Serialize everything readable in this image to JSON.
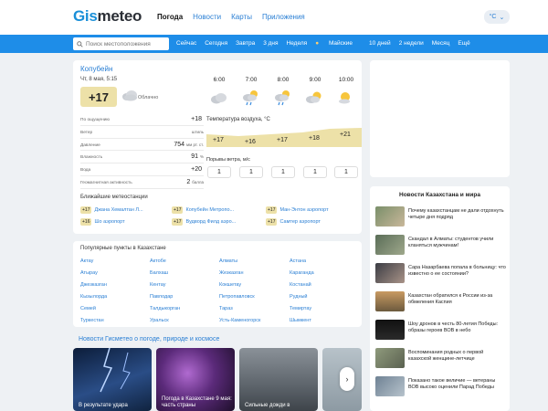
{
  "header": {
    "logo_g": "Gis",
    "logo_m": "meteo",
    "nav": [
      "Погода",
      "Новости",
      "Карты",
      "Приложения"
    ],
    "unit": "°C"
  },
  "search": {
    "placeholder": "Поиск местоположения"
  },
  "daynav": [
    "Сейчас",
    "Сегодня",
    "Завтра",
    "3 дня",
    "Неделя",
    "Майские",
    "10 дней",
    "2 недели",
    "Месяц",
    "Ещё"
  ],
  "current": {
    "city": "Копубейн",
    "datetime": "Чт, 8 мая, 5:15",
    "temp": "+17",
    "desc": "Облачно",
    "params": [
      {
        "k": "По ощущению",
        "v": "+18",
        "u": ""
      },
      {
        "k": "Ветер",
        "v": "",
        "u": "штиль"
      },
      {
        "k": "Давление",
        "v": "754",
        "u": "мм рт. ст."
      },
      {
        "k": "Влажность",
        "v": "91",
        "u": "%"
      },
      {
        "k": "Вода",
        "v": "+20",
        "u": ""
      },
      {
        "k": "Геомагнитная активность",
        "v": "2",
        "u": "балла"
      }
    ]
  },
  "hourly": {
    "times": [
      "6:00",
      "7:00",
      "8:00",
      "9:00",
      "10:00"
    ],
    "temp_header": "Температура воздуха, °С",
    "temps": [
      "+17",
      "+16",
      "+17",
      "+18",
      "+21"
    ],
    "gust_header": "Порывы ветра, м/с",
    "gusts": [
      "1",
      "1",
      "1",
      "1",
      "1"
    ]
  },
  "stations": {
    "title": "Ближайшие метеостанции",
    "items": [
      {
        "t": "+17",
        "n": "Джана Хемалтан Л..."
      },
      {
        "t": "+17",
        "n": "Копубейн Метропо..."
      },
      {
        "t": "+17",
        "n": "Ман-Энтон аэропорт"
      },
      {
        "t": "+16",
        "n": "Шо аэропорт"
      },
      {
        "t": "+17",
        "n": "Вудворд Филд аэро..."
      },
      {
        "t": "+17",
        "n": "Самтер аэропорт"
      }
    ]
  },
  "popular": {
    "title": "Популярные пункты в Казахстане",
    "cols": [
      [
        "Актау",
        "Атырау",
        "Джезказган",
        "Кызылорда",
        "Семей",
        "Туркестан"
      ],
      [
        "Актобе",
        "Балхаш",
        "Кентау",
        "Павлодар",
        "Талдыкорган",
        "Уральск"
      ],
      [
        "Алматы",
        "Жезказган",
        "Кокшетау",
        "Петропавловск",
        "Тараз",
        "Усть-Каменогорск"
      ],
      [
        "Астана",
        "Караганда",
        "Костанай",
        "Рудный",
        "Темиртау",
        "Шымкент"
      ]
    ]
  },
  "gnews": {
    "title": "Новости Гисметео о погоде, природе и космосе",
    "tiles": [
      "В результате удара",
      "Погода в Казахстане 9 мая: часть страны",
      "Сильные дожди в",
      ""
    ]
  },
  "kznews": {
    "title": "Новости Казахстана и мира",
    "items": [
      "Почему казахстанцам не дали отдохнуть четыре дня подряд",
      "Скандал в Алматы: студентов учили кланяться мужчинам!",
      "Сара Назарбаева попала в больницу: что известно о ее состоянии?",
      "Казахстан обратился к России из-за обмеления Каспия",
      "Шоу дронов в честь 80-летия Победы: образы героев ВОВ в небо",
      "Воспоминания родных о первой казахской женщине-летчице",
      "Показано такое величие — ветераны ВОВ высоко оценили Парад Победы"
    ]
  },
  "colors": {
    "brand": "#1e8de8",
    "temp_bg": "#ede1a8",
    "link": "#2a7fd4"
  }
}
